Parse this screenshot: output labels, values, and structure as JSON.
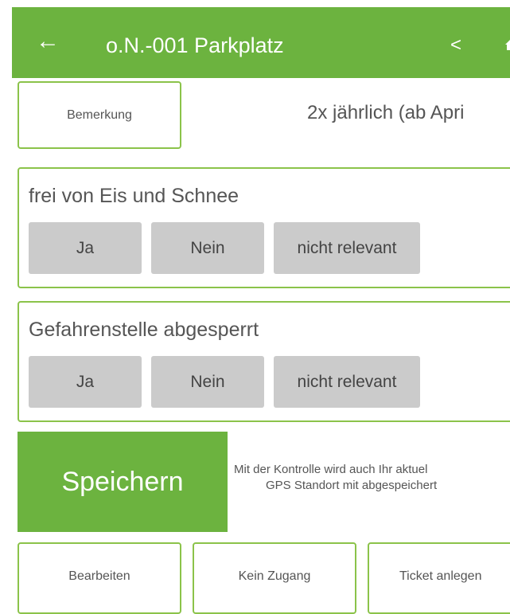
{
  "header": {
    "back_icon": "arrow-left-icon",
    "back_glyph": "←",
    "title": "o.N.-001 Parkplatz",
    "prev_icon": "chevron-left-icon",
    "prev_glyph": "<",
    "home_icon": "home-icon"
  },
  "remark": {
    "button_label": "Bemerkung",
    "interval_text": "2x jährlich (ab Apri"
  },
  "checks": [
    {
      "label": "frei von Eis und Schnee",
      "options": [
        "Ja",
        "Nein",
        "nicht relevant"
      ]
    },
    {
      "label": "Gefahrenstelle abgesperrt",
      "options": [
        "Ja",
        "Nein",
        "nicht relevant"
      ]
    }
  ],
  "save": {
    "button_label": "Speichern",
    "note_line1": "Mit der Kontrolle wird auch Ihr aktuel",
    "note_line2": "GPS Standort mit abgespeichert"
  },
  "footer": {
    "edit_label": "Bearbeiten",
    "no_access_label": "Kein Zugang",
    "ticket_label": "Ticket anlegen"
  },
  "colors": {
    "brand_green": "#6cb33f",
    "border_green": "#8bc34a",
    "option_gray": "#cbcbcb"
  }
}
